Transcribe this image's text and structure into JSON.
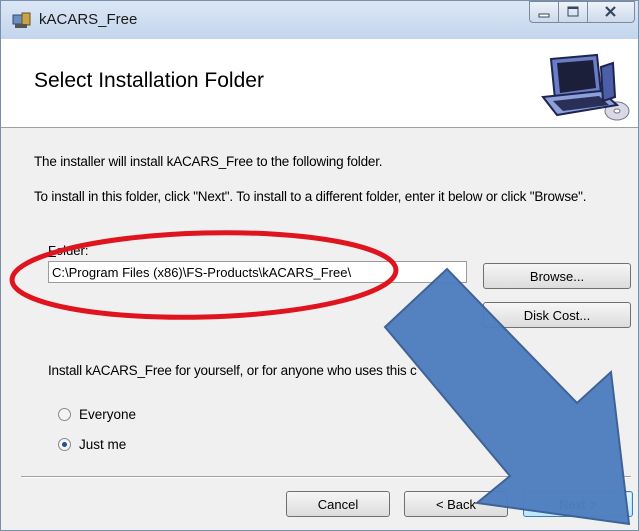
{
  "window": {
    "title": "kACARS_Free",
    "controls": {
      "minimize": "minimize-icon",
      "maximize": "maximize-icon",
      "close": "close-icon"
    }
  },
  "header": {
    "title": "Select Installation Folder",
    "art_icon": "computer-install-icon"
  },
  "body": {
    "line1": "The installer will install kACARS_Free to the following folder.",
    "line2": "To install in this folder, click \"Next\". To install to a different folder, enter it below or click \"Browse\".",
    "folder_label_accel": "F",
    "folder_label_rest": "older:",
    "folder_value": "C:\\Program Files (x86)\\FS-Products\\kACARS_Free\\",
    "browse_label": "Browse...",
    "disk_cost_label": "Disk Cost...",
    "install_for_text": "Install kACARS_Free for yourself, or for anyone who uses this c",
    "options": [
      {
        "label": "Everyone",
        "selected": false
      },
      {
        "label": "Just me",
        "selected": true
      }
    ]
  },
  "footer": {
    "cancel_label": "Cancel",
    "back_label": "< Back",
    "next_label": "Next >"
  },
  "annotations": {
    "highlight_ellipse_color": "#e0141e",
    "arrow_color": "#4f7fbf",
    "arrow_outline_color": "#3a5f95"
  }
}
